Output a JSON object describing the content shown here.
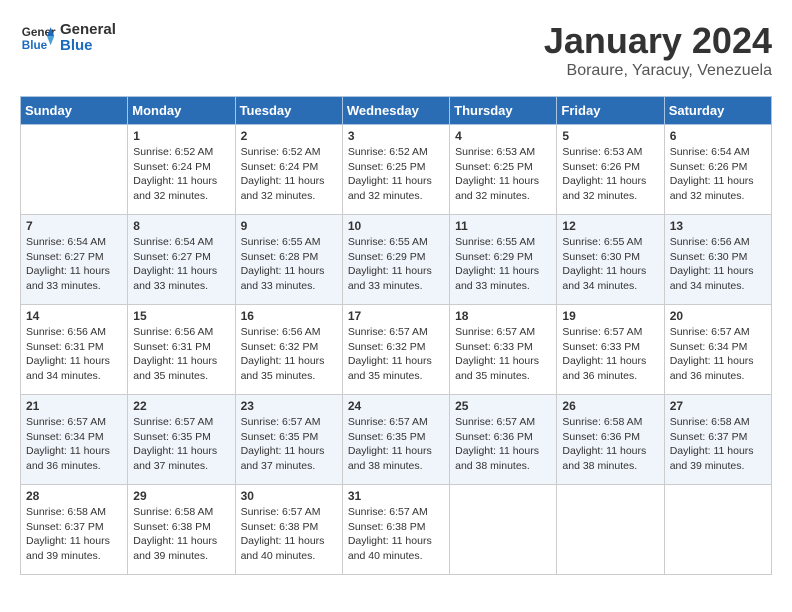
{
  "header": {
    "logo_line1": "General",
    "logo_line2": "Blue",
    "title": "January 2024",
    "subtitle": "Boraure, Yaracuy, Venezuela"
  },
  "columns": [
    "Sunday",
    "Monday",
    "Tuesday",
    "Wednesday",
    "Thursday",
    "Friday",
    "Saturday"
  ],
  "weeks": [
    [
      {
        "day": "",
        "info": ""
      },
      {
        "day": "1",
        "info": "Sunrise: 6:52 AM\nSunset: 6:24 PM\nDaylight: 11 hours\nand 32 minutes."
      },
      {
        "day": "2",
        "info": "Sunrise: 6:52 AM\nSunset: 6:24 PM\nDaylight: 11 hours\nand 32 minutes."
      },
      {
        "day": "3",
        "info": "Sunrise: 6:52 AM\nSunset: 6:25 PM\nDaylight: 11 hours\nand 32 minutes."
      },
      {
        "day": "4",
        "info": "Sunrise: 6:53 AM\nSunset: 6:25 PM\nDaylight: 11 hours\nand 32 minutes."
      },
      {
        "day": "5",
        "info": "Sunrise: 6:53 AM\nSunset: 6:26 PM\nDaylight: 11 hours\nand 32 minutes."
      },
      {
        "day": "6",
        "info": "Sunrise: 6:54 AM\nSunset: 6:26 PM\nDaylight: 11 hours\nand 32 minutes."
      }
    ],
    [
      {
        "day": "7",
        "info": "Sunrise: 6:54 AM\nSunset: 6:27 PM\nDaylight: 11 hours\nand 33 minutes."
      },
      {
        "day": "8",
        "info": "Sunrise: 6:54 AM\nSunset: 6:27 PM\nDaylight: 11 hours\nand 33 minutes."
      },
      {
        "day": "9",
        "info": "Sunrise: 6:55 AM\nSunset: 6:28 PM\nDaylight: 11 hours\nand 33 minutes."
      },
      {
        "day": "10",
        "info": "Sunrise: 6:55 AM\nSunset: 6:29 PM\nDaylight: 11 hours\nand 33 minutes."
      },
      {
        "day": "11",
        "info": "Sunrise: 6:55 AM\nSunset: 6:29 PM\nDaylight: 11 hours\nand 33 minutes."
      },
      {
        "day": "12",
        "info": "Sunrise: 6:55 AM\nSunset: 6:30 PM\nDaylight: 11 hours\nand 34 minutes."
      },
      {
        "day": "13",
        "info": "Sunrise: 6:56 AM\nSunset: 6:30 PM\nDaylight: 11 hours\nand 34 minutes."
      }
    ],
    [
      {
        "day": "14",
        "info": "Sunrise: 6:56 AM\nSunset: 6:31 PM\nDaylight: 11 hours\nand 34 minutes."
      },
      {
        "day": "15",
        "info": "Sunrise: 6:56 AM\nSunset: 6:31 PM\nDaylight: 11 hours\nand 35 minutes."
      },
      {
        "day": "16",
        "info": "Sunrise: 6:56 AM\nSunset: 6:32 PM\nDaylight: 11 hours\nand 35 minutes."
      },
      {
        "day": "17",
        "info": "Sunrise: 6:57 AM\nSunset: 6:32 PM\nDaylight: 11 hours\nand 35 minutes."
      },
      {
        "day": "18",
        "info": "Sunrise: 6:57 AM\nSunset: 6:33 PM\nDaylight: 11 hours\nand 35 minutes."
      },
      {
        "day": "19",
        "info": "Sunrise: 6:57 AM\nSunset: 6:33 PM\nDaylight: 11 hours\nand 36 minutes."
      },
      {
        "day": "20",
        "info": "Sunrise: 6:57 AM\nSunset: 6:34 PM\nDaylight: 11 hours\nand 36 minutes."
      }
    ],
    [
      {
        "day": "21",
        "info": "Sunrise: 6:57 AM\nSunset: 6:34 PM\nDaylight: 11 hours\nand 36 minutes."
      },
      {
        "day": "22",
        "info": "Sunrise: 6:57 AM\nSunset: 6:35 PM\nDaylight: 11 hours\nand 37 minutes."
      },
      {
        "day": "23",
        "info": "Sunrise: 6:57 AM\nSunset: 6:35 PM\nDaylight: 11 hours\nand 37 minutes."
      },
      {
        "day": "24",
        "info": "Sunrise: 6:57 AM\nSunset: 6:35 PM\nDaylight: 11 hours\nand 38 minutes."
      },
      {
        "day": "25",
        "info": "Sunrise: 6:57 AM\nSunset: 6:36 PM\nDaylight: 11 hours\nand 38 minutes."
      },
      {
        "day": "26",
        "info": "Sunrise: 6:58 AM\nSunset: 6:36 PM\nDaylight: 11 hours\nand 38 minutes."
      },
      {
        "day": "27",
        "info": "Sunrise: 6:58 AM\nSunset: 6:37 PM\nDaylight: 11 hours\nand 39 minutes."
      }
    ],
    [
      {
        "day": "28",
        "info": "Sunrise: 6:58 AM\nSunset: 6:37 PM\nDaylight: 11 hours\nand 39 minutes."
      },
      {
        "day": "29",
        "info": "Sunrise: 6:58 AM\nSunset: 6:38 PM\nDaylight: 11 hours\nand 39 minutes."
      },
      {
        "day": "30",
        "info": "Sunrise: 6:57 AM\nSunset: 6:38 PM\nDaylight: 11 hours\nand 40 minutes."
      },
      {
        "day": "31",
        "info": "Sunrise: 6:57 AM\nSunset: 6:38 PM\nDaylight: 11 hours\nand 40 minutes."
      },
      {
        "day": "",
        "info": ""
      },
      {
        "day": "",
        "info": ""
      },
      {
        "day": "",
        "info": ""
      }
    ]
  ]
}
